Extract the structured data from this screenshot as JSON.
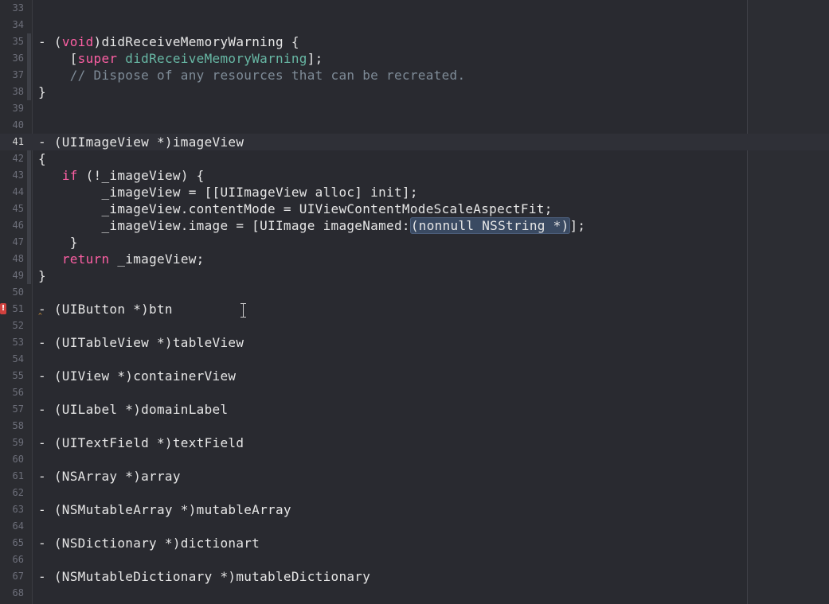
{
  "editor": {
    "lines": [
      {
        "n": "33",
        "segs": []
      },
      {
        "n": "34",
        "segs": []
      },
      {
        "n": "35",
        "segs": [
          {
            "t": "- ("
          },
          {
            "t": "void",
            "c": "kw"
          },
          {
            "t": ")didReceiveMemoryWarning {"
          }
        ]
      },
      {
        "n": "36",
        "segs": [
          {
            "t": "    ["
          },
          {
            "t": "super",
            "c": "kw"
          },
          {
            "t": " "
          },
          {
            "t": "didReceiveMemoryWarning",
            "c": "sym"
          },
          {
            "t": "];"
          }
        ]
      },
      {
        "n": "37",
        "segs": [
          {
            "t": "    "
          },
          {
            "t": "// Dispose of any resources that can be recreated.",
            "c": "cmt"
          }
        ]
      },
      {
        "n": "38",
        "segs": [
          {
            "t": "}"
          }
        ]
      },
      {
        "n": "39",
        "segs": []
      },
      {
        "n": "40",
        "segs": []
      },
      {
        "n": "41",
        "current": true,
        "segs": [
          {
            "t": "- (UIImageView *)imageView"
          }
        ]
      },
      {
        "n": "42",
        "segs": [
          {
            "t": "{"
          }
        ]
      },
      {
        "n": "43",
        "segs": [
          {
            "t": "   "
          },
          {
            "t": "if",
            "c": "kw"
          },
          {
            "t": " (!_imageView) {"
          }
        ]
      },
      {
        "n": "44",
        "segs": [
          {
            "t": "        _imageView = [[UIImageView alloc] init];"
          }
        ]
      },
      {
        "n": "45",
        "segs": [
          {
            "t": "        _imageView.contentMode = UIViewContentModeScaleAspectFit;"
          }
        ]
      },
      {
        "n": "46",
        "segs": [
          {
            "t": "        _imageView.image = [UIImage imageNamed:"
          },
          {
            "t": "(nonnull NSString *)",
            "c": "ph"
          },
          {
            "t": "];"
          }
        ]
      },
      {
        "n": "47",
        "segs": [
          {
            "t": "    }"
          }
        ]
      },
      {
        "n": "48",
        "segs": [
          {
            "t": "   "
          },
          {
            "t": "return",
            "c": "kw"
          },
          {
            "t": " _imageView;"
          }
        ]
      },
      {
        "n": "49",
        "segs": [
          {
            "t": "}"
          }
        ]
      },
      {
        "n": "50",
        "segs": []
      },
      {
        "n": "51",
        "error": true,
        "segs": [
          {
            "t": "- (UIButton *)btn"
          }
        ]
      },
      {
        "n": "52",
        "segs": []
      },
      {
        "n": "53",
        "segs": [
          {
            "t": "- (UITableView *)tableView"
          }
        ]
      },
      {
        "n": "54",
        "segs": []
      },
      {
        "n": "55",
        "segs": [
          {
            "t": "- (UIView *)containerView"
          }
        ]
      },
      {
        "n": "56",
        "segs": []
      },
      {
        "n": "57",
        "segs": [
          {
            "t": "- (UILabel *)domainLabel"
          }
        ]
      },
      {
        "n": "58",
        "segs": []
      },
      {
        "n": "59",
        "segs": [
          {
            "t": "- (UITextField *)textField"
          }
        ]
      },
      {
        "n": "60",
        "segs": []
      },
      {
        "n": "61",
        "segs": [
          {
            "t": "- (NSArray *)array"
          }
        ]
      },
      {
        "n": "62",
        "segs": []
      },
      {
        "n": "63",
        "segs": [
          {
            "t": "- (NSMutableArray *)mutableArray"
          }
        ]
      },
      {
        "n": "64",
        "segs": []
      },
      {
        "n": "65",
        "segs": [
          {
            "t": "- (NSDictionary *)dictionart"
          }
        ]
      },
      {
        "n": "66",
        "segs": []
      },
      {
        "n": "67",
        "segs": [
          {
            "t": "- (NSMutableDictionary *)mutableDictionary"
          }
        ]
      },
      {
        "n": "68",
        "segs": []
      }
    ],
    "error_icon": "error-icon",
    "error_glyph": "!",
    "warning_glyph": "^",
    "cursor_icon": "ibeam-cursor-icon",
    "colors": {
      "background": "#292a30",
      "keyword": "#fc5fa3",
      "method": "#67b7a4",
      "comment": "#7f8c98",
      "placeholder": "#3a4a62",
      "error": "#d0413e"
    }
  }
}
